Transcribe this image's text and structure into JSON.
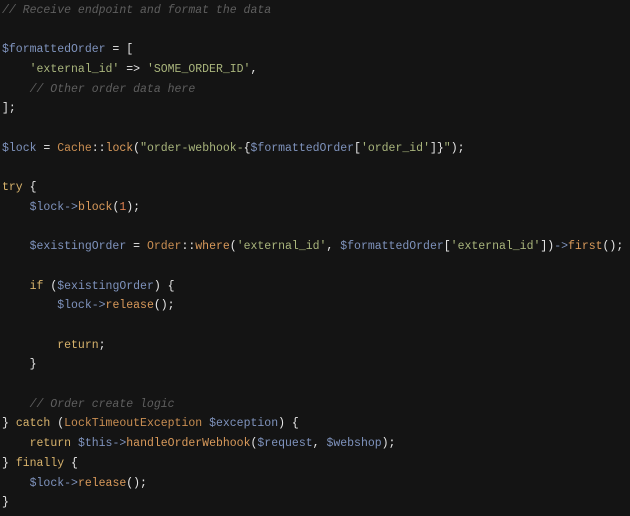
{
  "editor": {
    "language": "php",
    "colors": {
      "background": "#141414",
      "comment": "#5f5f5f",
      "variable": "#7f93bd",
      "keyword": "#d8b36c",
      "function": "#d99a5b",
      "class": "#c98e52",
      "string": "#a9b57c",
      "number": "#dd7f50"
    },
    "lines": [
      [
        [
          "c",
          "// Receive endpoint and format the data"
        ]
      ],
      [],
      [
        [
          "v",
          "$formattedOrder"
        ],
        [
          "p",
          " = ["
        ]
      ],
      [
        [
          "p",
          "    "
        ],
        [
          "s",
          "'external_id'"
        ],
        [
          "p",
          " => "
        ],
        [
          "s",
          "'SOME_ORDER_ID'"
        ],
        [
          "p",
          ","
        ]
      ],
      [
        [
          "c",
          "    // Other order data here"
        ]
      ],
      [
        [
          "p",
          "];"
        ]
      ],
      [],
      [
        [
          "v",
          "$lock"
        ],
        [
          "p",
          " = "
        ],
        [
          "cl",
          "Cache"
        ],
        [
          "p",
          "::"
        ],
        [
          "f",
          "lock"
        ],
        [
          "p",
          "("
        ],
        [
          "s",
          "\"order-webhook-"
        ],
        [
          "p",
          "{"
        ],
        [
          "v",
          "$formattedOrder"
        ],
        [
          "p",
          "["
        ],
        [
          "s",
          "'order_id'"
        ],
        [
          "p",
          "]}"
        ],
        [
          "s",
          "\""
        ],
        [
          "p",
          ");"
        ]
      ],
      [],
      [
        [
          "k",
          "try"
        ],
        [
          "p",
          " {"
        ]
      ],
      [
        [
          "p",
          "    "
        ],
        [
          "v",
          "$lock"
        ],
        [
          "o",
          "->"
        ],
        [
          "f",
          "block"
        ],
        [
          "p",
          "("
        ],
        [
          "n",
          "1"
        ],
        [
          "p",
          ");"
        ]
      ],
      [],
      [
        [
          "p",
          "    "
        ],
        [
          "v",
          "$existingOrder"
        ],
        [
          "p",
          " = "
        ],
        [
          "cl",
          "Order"
        ],
        [
          "p",
          "::"
        ],
        [
          "f",
          "where"
        ],
        [
          "p",
          "("
        ],
        [
          "s",
          "'external_id'"
        ],
        [
          "p",
          ", "
        ],
        [
          "v",
          "$formattedOrder"
        ],
        [
          "p",
          "["
        ],
        [
          "s",
          "'external_id'"
        ],
        [
          "p",
          "])"
        ],
        [
          "o",
          "->"
        ],
        [
          "f",
          "first"
        ],
        [
          "p",
          "();"
        ]
      ],
      [],
      [
        [
          "p",
          "    "
        ],
        [
          "k",
          "if"
        ],
        [
          "p",
          " ("
        ],
        [
          "v",
          "$existingOrder"
        ],
        [
          "p",
          ") {"
        ]
      ],
      [
        [
          "p",
          "        "
        ],
        [
          "v",
          "$lock"
        ],
        [
          "o",
          "->"
        ],
        [
          "f",
          "release"
        ],
        [
          "p",
          "();"
        ]
      ],
      [],
      [
        [
          "p",
          "        "
        ],
        [
          "k",
          "return"
        ],
        [
          "p",
          ";"
        ]
      ],
      [
        [
          "p",
          "    }"
        ]
      ],
      [],
      [
        [
          "c",
          "    // Order create logic"
        ]
      ],
      [
        [
          "p",
          "} "
        ],
        [
          "k",
          "catch"
        ],
        [
          "p",
          " ("
        ],
        [
          "cl",
          "LockTimeoutException"
        ],
        [
          "p",
          " "
        ],
        [
          "v",
          "$exception"
        ],
        [
          "p",
          ") {"
        ]
      ],
      [
        [
          "p",
          "    "
        ],
        [
          "k",
          "return"
        ],
        [
          "p",
          " "
        ],
        [
          "v",
          "$this"
        ],
        [
          "o",
          "->"
        ],
        [
          "f",
          "handleOrderWebhook"
        ],
        [
          "p",
          "("
        ],
        [
          "v",
          "$request"
        ],
        [
          "p",
          ", "
        ],
        [
          "v",
          "$webshop"
        ],
        [
          "p",
          ");"
        ]
      ],
      [
        [
          "p",
          "} "
        ],
        [
          "k",
          "finally"
        ],
        [
          "p",
          " {"
        ]
      ],
      [
        [
          "p",
          "    "
        ],
        [
          "v",
          "$lock"
        ],
        [
          "o",
          "->"
        ],
        [
          "f",
          "release"
        ],
        [
          "p",
          "();"
        ]
      ],
      [
        [
          "p",
          "}"
        ]
      ]
    ]
  }
}
